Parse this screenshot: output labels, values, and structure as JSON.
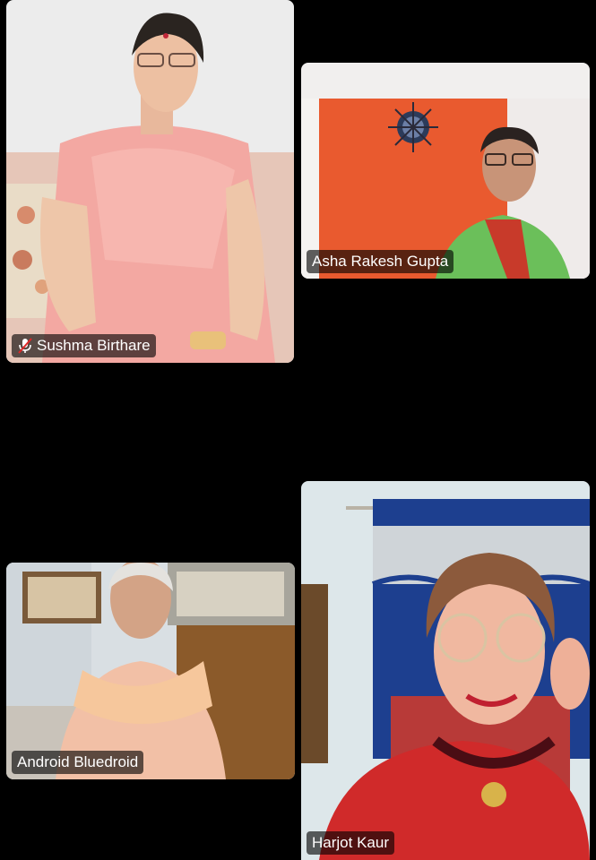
{
  "participants": [
    {
      "name": "Sushma Birthare",
      "muted": true,
      "icon": "mic-muted-icon"
    },
    {
      "name": "Asha Rakesh Gupta",
      "muted": false
    },
    {
      "name": "Android Bluedroid",
      "muted": false
    },
    {
      "name": "Harjot Kaur",
      "muted": false
    }
  ]
}
